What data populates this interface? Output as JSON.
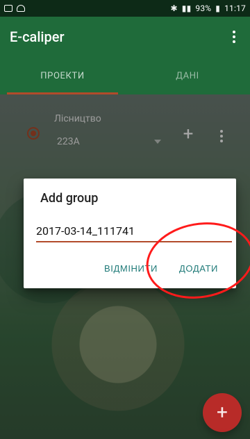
{
  "statusbar": {
    "battery_percent": "93%",
    "time": "11:17"
  },
  "appbar": {
    "title": "E-caliper"
  },
  "tabs": [
    {
      "label": "ПРОЕКТИ",
      "active": true
    },
    {
      "label": "ДАНІ",
      "active": false
    }
  ],
  "row": {
    "label": "Лісництво",
    "value": "223A"
  },
  "dialog": {
    "title": "Add group",
    "input_value": "2017-03-14_111741",
    "cancel_label": "ВІДМІНИТИ",
    "add_label": "ДОДАТИ"
  },
  "fab": {
    "label": "+"
  },
  "colors": {
    "primary": "#1f6b3a",
    "accent": "#b24b2a",
    "teal_button": "#1f7a78",
    "fab": "#d22828",
    "annotation": "#ff1b1b"
  },
  "icons": {
    "kebab_menu": "vertical-dots",
    "dropdown": "triangle-down",
    "plus": "plus"
  }
}
